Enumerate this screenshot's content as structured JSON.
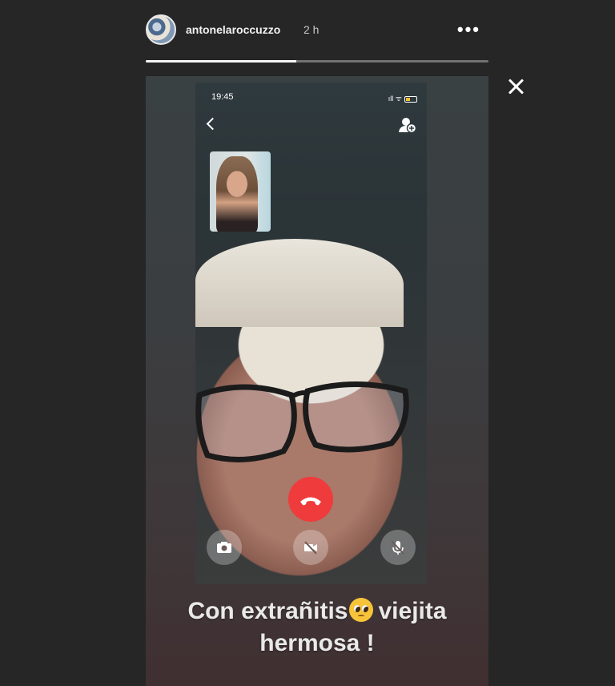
{
  "header": {
    "username": "antonelaroccuzzo",
    "time_ago": "2 h",
    "more_icon": "more-horizontal-icon",
    "more_label": "•••",
    "progress": 0.44
  },
  "close_icon": "close-icon",
  "phone": {
    "status_time": "19:45",
    "signal_text": "ıll ᯤ",
    "back_icon": "chevron-left-icon",
    "add_person_icon": "add-person-icon",
    "end_call_icon": "phone-hangup-icon",
    "controls": [
      {
        "name": "camera-switch-icon"
      },
      {
        "name": "video-off-icon"
      },
      {
        "name": "mic-off-icon"
      }
    ]
  },
  "caption": {
    "line1_before": "Con extrañitis",
    "emoji": "pleading-face-emoji",
    "line1_after": "viejita",
    "line2": "hermosa !"
  },
  "colors": {
    "end_call": "#ef3b3b",
    "background": "#262626",
    "battery": "#f2c230"
  }
}
